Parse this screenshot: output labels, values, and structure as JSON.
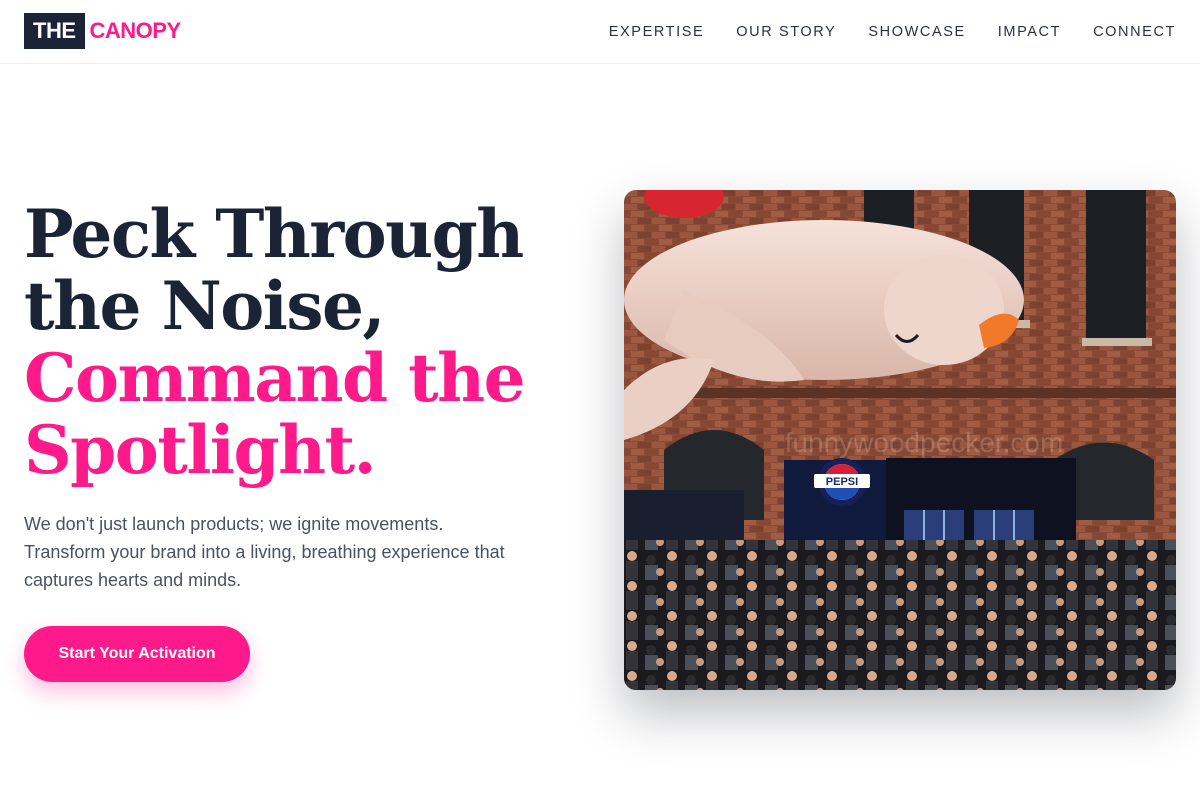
{
  "brand": {
    "logo_box": "THE",
    "logo_text": "CANOPY"
  },
  "nav": {
    "items": [
      "EXPERTISE",
      "OUR STORY",
      "SHOWCASE",
      "IMPACT",
      "CONNECT"
    ]
  },
  "hero": {
    "title_line1": "Peck Through",
    "title_line2": "the Noise,",
    "title_line3": "Command the",
    "title_line4": "Spotlight.",
    "description": "We don't just launch products; we ignite movements. Transform your brand into a living, breathing experience that captures hearts and minds.",
    "cta_label": "Start Your Activation"
  },
  "image": {
    "booth_sign": "PEPSI",
    "watermark": "funnywoodpecker.com"
  },
  "colors": {
    "accent": "#ff1a8c",
    "dark": "#1b2437",
    "body_text": "#4a5163"
  }
}
